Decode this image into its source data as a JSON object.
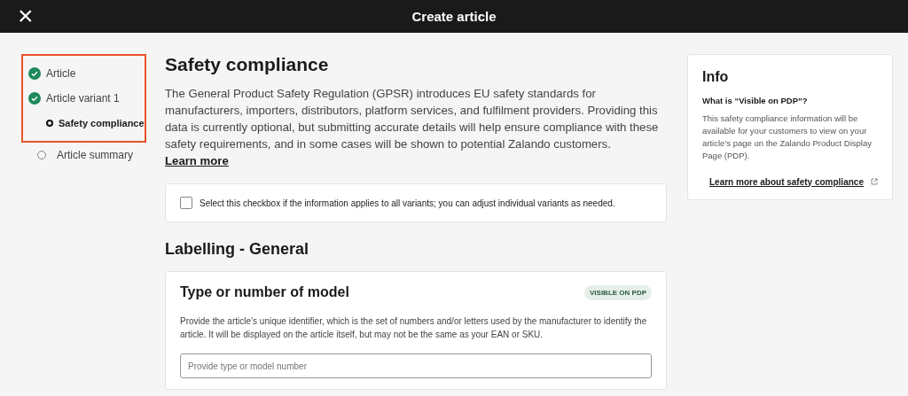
{
  "header": {
    "close_icon": "×",
    "title": "Create article"
  },
  "steps": [
    {
      "label": "Article",
      "kind": "done",
      "selected": false,
      "highlighted": true
    },
    {
      "label": "Article variant 1",
      "kind": "done",
      "selected": false,
      "highlighted": true
    },
    {
      "label": "Safety compliance",
      "kind": "sub",
      "selected": true,
      "highlighted": true
    },
    {
      "label": "Article summary",
      "kind": "todo",
      "selected": false,
      "highlighted": false
    }
  ],
  "main": {
    "title": "Safety compliance",
    "description": "The General Product Safety Regulation (GPSR) introduces EU safety standards for manufacturers, importers, distributors, platform services, and fulfilment providers. Providing this data is currently optional, but submitting accurate details will help ensure compliance with these safety requirements, and in some cases will be shown to potential Zalando customers.",
    "link": "Learn more",
    "apply_all": {
      "label": "Select this checkbox if the information applies to all variants; you can adjust individual variants as needed.",
      "checked": false
    },
    "section_title": "Labelling - General",
    "field_card": {
      "title": "Type or number of model",
      "badge": "VISIBLE ON PDP",
      "help": "Provide the article’s unique identifier, which is the set of numbers and/or letters used by the manufacturer to identify the article. It will be displayed on the article itself, but may not be the same as your EAN or SKU.",
      "placeholder": "Provide type or model number"
    }
  },
  "info": {
    "title": "Info",
    "question": "What is “Visible on PDP”?",
    "text": "This safety compliance information will be available for your customers to view on your article’s page on the Zalando Product Display Page (PDP).",
    "link": "Learn more about safety compliance"
  }
}
